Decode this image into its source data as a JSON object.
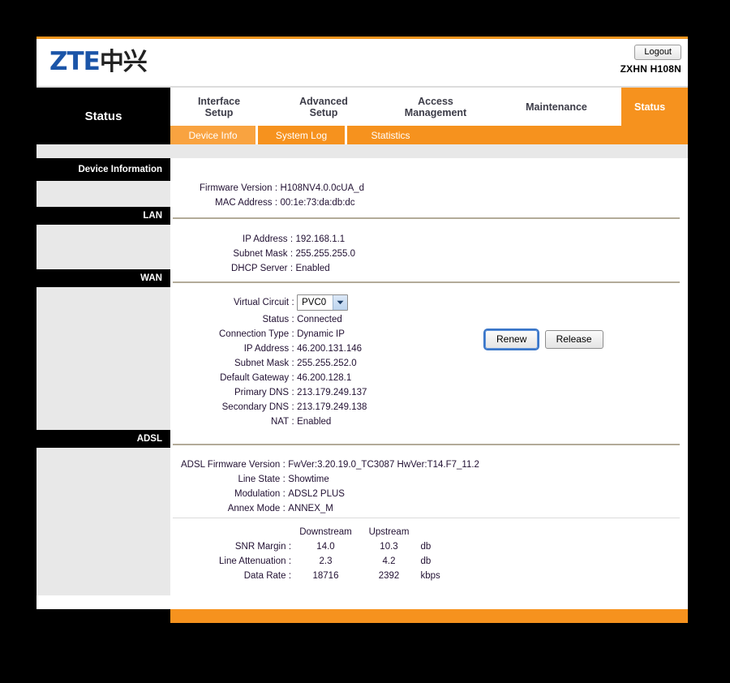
{
  "brand": {
    "logo_latin": "ZTE",
    "logo_cjk": "中兴",
    "model": "ZXHN H108N",
    "logout_label": "Logout",
    "accent_color": "#F6921E",
    "active_tab_color": "#F9A340",
    "logo_blue": "#1B55A8"
  },
  "nav": {
    "current_section": "Status",
    "items": [
      {
        "line1": "Interface",
        "line2": "Setup"
      },
      {
        "line1": "Advanced",
        "line2": "Setup"
      },
      {
        "line1": "Access",
        "line2": "Management"
      },
      {
        "line1": "Maintenance",
        "line2": ""
      },
      {
        "line1": "Status",
        "line2": ""
      }
    ],
    "subtabs": [
      {
        "label": "Device Info",
        "active": true
      },
      {
        "label": "System Log",
        "active": false
      },
      {
        "label": "Statistics",
        "active": false
      }
    ]
  },
  "sidebar": {
    "sections": [
      {
        "label": "Device Information"
      },
      {
        "label": "LAN"
      },
      {
        "label": "WAN"
      },
      {
        "label": "ADSL"
      }
    ]
  },
  "device_information": {
    "rows": [
      {
        "key": "Firmware Version",
        "sep": ":",
        "value": "H108NV4.0.0cUA_d"
      },
      {
        "key": "MAC Address",
        "sep": ":",
        "value": "00:1e:73:da:db:dc"
      }
    ]
  },
  "lan": {
    "rows": [
      {
        "key": "IP Address",
        "sep": ":",
        "value": "192.168.1.1"
      },
      {
        "key": "Subnet Mask",
        "sep": ":",
        "value": "255.255.255.0"
      },
      {
        "key": "DHCP Server",
        "sep": ":",
        "value": "Enabled"
      }
    ]
  },
  "wan": {
    "virtual_circuit_label": "Virtual Circuit",
    "virtual_circuit_sep": ":",
    "virtual_circuit_value": "PVC0",
    "rows": [
      {
        "key": "Status",
        "sep": ":",
        "value": "Connected"
      },
      {
        "key": "Connection Type",
        "sep": ":",
        "value": "Dynamic IP"
      },
      {
        "key": "IP Address",
        "sep": ":",
        "value": "46.200.131.146"
      },
      {
        "key": "Subnet Mask",
        "sep": ":",
        "value": "255.255.252.0"
      },
      {
        "key": "Default Gateway",
        "sep": ":",
        "value": "46.200.128.1"
      },
      {
        "key": "Primary DNS",
        "sep": ":",
        "value": "213.179.249.137"
      },
      {
        "key": "Secondary DNS",
        "sep": ":",
        "value": "213.179.249.138"
      },
      {
        "key": "NAT",
        "sep": ":",
        "value": "Enabled"
      }
    ],
    "renew_label": "Renew",
    "release_label": "Release"
  },
  "adsl": {
    "rows": [
      {
        "key": "ADSL Firmware Version",
        "sep": ":",
        "value": "FwVer:3.20.19.0_TC3087 HwVer:T14.F7_11.2"
      },
      {
        "key": "Line State",
        "sep": ":",
        "value": "Showtime"
      },
      {
        "key": "Modulation",
        "sep": ":",
        "value": "ADSL2 PLUS"
      },
      {
        "key": "Annex Mode",
        "sep": ":",
        "value": "ANNEX_M"
      }
    ],
    "stats": {
      "col_headers": [
        "Downstream",
        "Upstream"
      ],
      "rows": [
        {
          "key": "SNR Margin",
          "sep": ":",
          "downstream": "14.0",
          "upstream": "10.3",
          "unit": "db"
        },
        {
          "key": "Line Attenuation",
          "sep": ":",
          "downstream": "2.3",
          "upstream": "4.2",
          "unit": "db"
        },
        {
          "key": "Data Rate",
          "sep": ":",
          "downstream": "18716",
          "upstream": "2392",
          "unit": "kbps"
        }
      ]
    }
  }
}
